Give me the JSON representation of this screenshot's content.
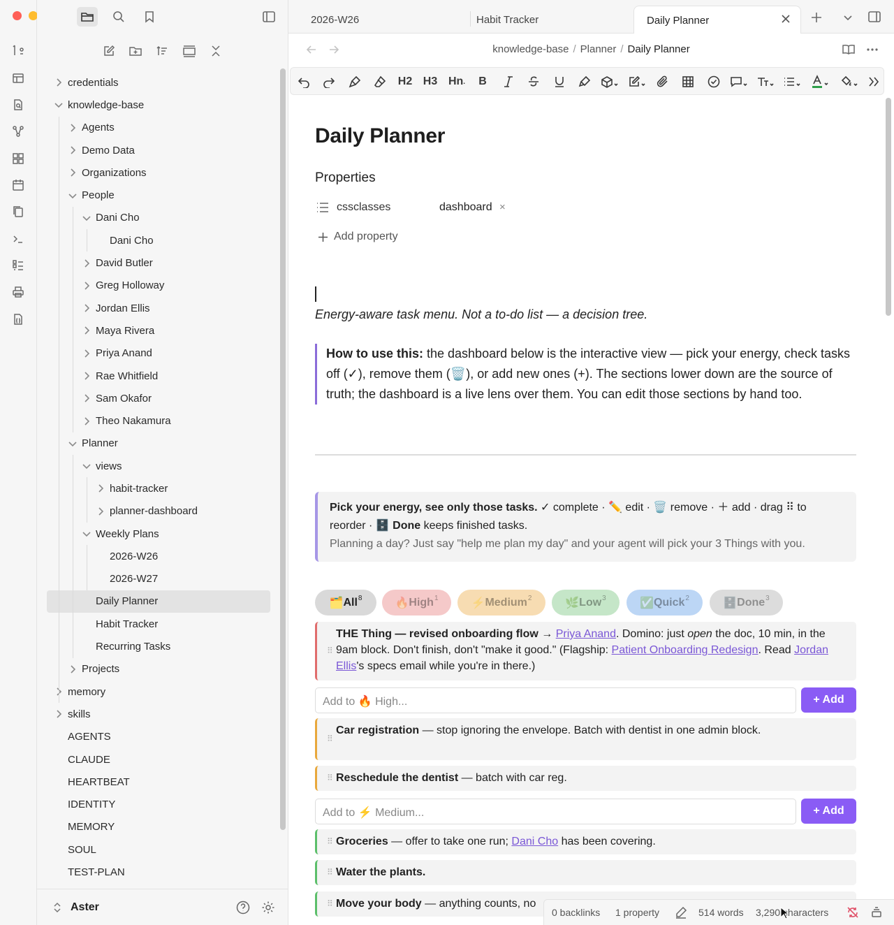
{
  "window": {
    "traffic_colors": [
      "#ff5f57",
      "#febc2e",
      "#28c840"
    ]
  },
  "ribbon": {
    "icons": [
      "graph-switcher-icon",
      "canvas-icon",
      "search-file-icon",
      "graph-view-icon",
      "blocks-icon",
      "calendar-icon",
      "copy-file-icon",
      "terminal-icon",
      "checklist-icon",
      "print-icon",
      "json-file-icon"
    ]
  },
  "sidebar": {
    "tree": [
      {
        "label": "credentials",
        "depth": 0,
        "chev": "right"
      },
      {
        "label": "knowledge-base",
        "depth": 0,
        "chev": "down"
      },
      {
        "label": "Agents",
        "depth": 1,
        "chev": "right"
      },
      {
        "label": "Demo Data",
        "depth": 1,
        "chev": "right"
      },
      {
        "label": "Organizations",
        "depth": 1,
        "chev": "right"
      },
      {
        "label": "People",
        "depth": 1,
        "chev": "down"
      },
      {
        "label": "Dani Cho",
        "depth": 2,
        "chev": "down"
      },
      {
        "label": "Dani Cho",
        "depth": 3,
        "chev": ""
      },
      {
        "label": "David Butler",
        "depth": 2,
        "chev": "right"
      },
      {
        "label": "Greg Holloway",
        "depth": 2,
        "chev": "right"
      },
      {
        "label": "Jordan Ellis",
        "depth": 2,
        "chev": "right"
      },
      {
        "label": "Maya Rivera",
        "depth": 2,
        "chev": "right"
      },
      {
        "label": "Priya Anand",
        "depth": 2,
        "chev": "right"
      },
      {
        "label": "Rae Whitfield",
        "depth": 2,
        "chev": "right"
      },
      {
        "label": "Sam Okafor",
        "depth": 2,
        "chev": "right"
      },
      {
        "label": "Theo Nakamura",
        "depth": 2,
        "chev": "right"
      },
      {
        "label": "Planner",
        "depth": 1,
        "chev": "down"
      },
      {
        "label": "views",
        "depth": 2,
        "chev": "down"
      },
      {
        "label": "habit-tracker",
        "depth": 3,
        "chev": "right"
      },
      {
        "label": "planner-dashboard",
        "depth": 3,
        "chev": "right"
      },
      {
        "label": "Weekly Plans",
        "depth": 2,
        "chev": "down"
      },
      {
        "label": "2026-W26",
        "depth": 3,
        "chev": ""
      },
      {
        "label": "2026-W27",
        "depth": 3,
        "chev": ""
      },
      {
        "label": "Daily Planner",
        "depth": 2,
        "chev": "",
        "selected": true
      },
      {
        "label": "Habit Tracker",
        "depth": 2,
        "chev": ""
      },
      {
        "label": "Recurring Tasks",
        "depth": 2,
        "chev": ""
      },
      {
        "label": "Projects",
        "depth": 1,
        "chev": "right"
      },
      {
        "label": "memory",
        "depth": 0,
        "chev": "right"
      },
      {
        "label": "skills",
        "depth": 0,
        "chev": "right"
      },
      {
        "label": "AGENTS",
        "depth": 0,
        "chev": ""
      },
      {
        "label": "CLAUDE",
        "depth": 0,
        "chev": ""
      },
      {
        "label": "HEARTBEAT",
        "depth": 0,
        "chev": ""
      },
      {
        "label": "IDENTITY",
        "depth": 0,
        "chev": ""
      },
      {
        "label": "MEMORY",
        "depth": 0,
        "chev": ""
      },
      {
        "label": "SOUL",
        "depth": 0,
        "chev": ""
      },
      {
        "label": "TEST-PLAN",
        "depth": 0,
        "chev": ""
      }
    ],
    "vault_name": "Aster"
  },
  "tabs": [
    {
      "label": "2026-W26"
    },
    {
      "label": "Habit Tracker"
    },
    {
      "label": "Daily Planner",
      "active": true
    }
  ],
  "breadcrumb": {
    "part1": "knowledge-base",
    "part2": "Planner",
    "current": "Daily Planner"
  },
  "toolbar": {
    "h2": "H2",
    "h3": "H3",
    "hn": "Hn",
    "bold": "B",
    "text_color": "#2e9e4a"
  },
  "doc": {
    "title": "Daily Planner",
    "properties_heading": "Properties",
    "property_key": "cssclasses",
    "property_value": "dashboard",
    "property_remove": "×",
    "add_property": "Add property",
    "tagline": "Energy-aware task menu. Not a to-do list — a decision tree.",
    "callout_bold": "How to use this:",
    "callout_text": " the dashboard below is the interactive view — pick your energy, check tasks off (✓), remove them (🗑️), or add new ones (+). The sections lower down are the source of truth; the dashboard is a live lens over them. You can edit those sections by hand too."
  },
  "dashboard": {
    "intro_bold": "Pick your energy, see only those tasks.",
    "intro_rest": " ✓ complete · ✏️ edit · 🗑️ remove · ＋ add · drag ⠿ to reorder · ",
    "intro_done_icon": "🗄️",
    "intro_done": "Done",
    "intro_done_rest": " keeps finished tasks.",
    "intro_sub": "Planning a day? Just say \"help me plan my day\" and your agent will pick your 3 Things with you.",
    "chips": [
      {
        "icon": "🗂️",
        "label": "All",
        "count": "8",
        "bg": "#d9d9d9"
      },
      {
        "icon": "🔥",
        "label": "High",
        "count": "1",
        "bg": "#f5c9c9"
      },
      {
        "icon": "⚡",
        "label": "Medium",
        "count": "2",
        "bg": "#f7dcb2"
      },
      {
        "icon": "🌿",
        "label": "Low",
        "count": "3",
        "bg": "#c5e6c8"
      },
      {
        "icon": "✅",
        "label": "Quick",
        "count": "2",
        "bg": "#bcd6f5"
      },
      {
        "icon": "🗄️",
        "label": "Done",
        "count": "3",
        "bg": "#dcdcdc"
      }
    ],
    "task1": {
      "bold": "THE Thing — revised onboarding flow →",
      "link1": "Priya Anand",
      "t1": ". Domino: just ",
      "em": "open",
      "t2": " the doc, 10 min, in the 9am block. Don't finish, don't \"make it good.\" (Flagship: ",
      "link2": "Patient Onboarding Redesign",
      "t3": ". Read ",
      "link3": "Jordan Ellis",
      "t4": "'s specs email while you're in there.)",
      "color": "#e06c6c"
    },
    "add_high": {
      "placeholder": "Add to 🔥 High...",
      "button": "+ Add"
    },
    "task2": {
      "bold": "Car registration",
      "rest": " — stop ignoring the envelope. Batch with dentist in one admin block.",
      "color": "#e8a83c"
    },
    "task3": {
      "bold": "Reschedule the dentist",
      "rest": " — batch with car reg.",
      "color": "#e8a83c"
    },
    "add_medium": {
      "placeholder": "Add to ⚡ Medium...",
      "button": "+ Add"
    },
    "task4": {
      "bold": "Groceries",
      "t1": " — offer to take one run; ",
      "link": "Dani Cho",
      "t2": " has been covering.",
      "color": "#5cbf6a"
    },
    "task5": {
      "bold": "Water the plants.",
      "color": "#5cbf6a"
    },
    "task6": {
      "bold": "Move your body",
      "rest": " — anything counts, no",
      "color": "#5cbf6a"
    }
  },
  "statusbar": {
    "backlinks": "0 backlinks",
    "properties": "1 property",
    "words": "514 words",
    "characters": "3,290 characters"
  }
}
